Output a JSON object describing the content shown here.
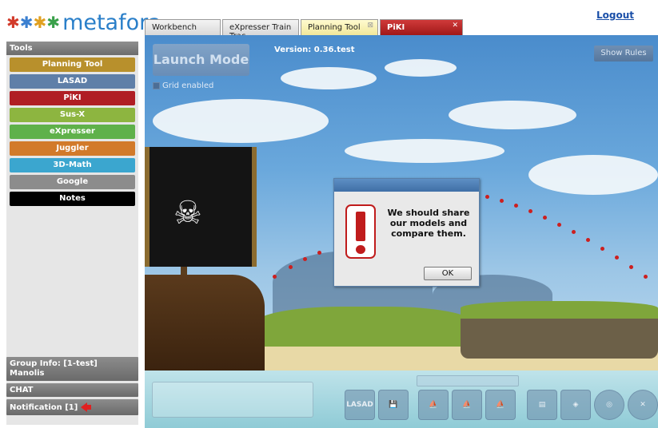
{
  "header": {
    "logo_text": "metafora",
    "logout_label": "Logout"
  },
  "tabs": [
    {
      "label": "Workbench",
      "state": "inactive"
    },
    {
      "label": "eXpresser Train Trac",
      "state": "inactive"
    },
    {
      "label": "Planning Tool",
      "state": "active",
      "close_glyph": "⊠"
    },
    {
      "label": "PiKI",
      "state": "highlighted",
      "close_glyph": "✕"
    }
  ],
  "sidebar": {
    "title": "Tools",
    "tools": [
      {
        "label": "Planning Tool",
        "color": "#b8902c"
      },
      {
        "label": "LASAD",
        "color": "#5f7fa8"
      },
      {
        "label": "PiKI",
        "color": "#b01e24"
      },
      {
        "label": "Sus-X",
        "color": "#8db540"
      },
      {
        "label": "eXpresser",
        "color": "#5fb14a"
      },
      {
        "label": "Juggler",
        "color": "#d27a2a"
      },
      {
        "label": "3D-Math",
        "color": "#3ba6cf"
      },
      {
        "label": "Google",
        "color": "#8c8c8c"
      },
      {
        "label": "Notes",
        "color": "#000000"
      }
    ],
    "group_info_line1": "Group Info: [1-test]",
    "group_info_line2": "Manolis",
    "chat_label": "CHAT",
    "notification_label": "Notification [1]"
  },
  "game": {
    "launch_mode_label": "Launch Mode",
    "version_text": "Version: 0.36.test",
    "show_rules_label": "Show Rules",
    "grid_enabled_label": "Grid enabled",
    "toolbar": {
      "lasad_label": "LASAD"
    }
  },
  "dialog": {
    "message": "We should share our models and compare them.",
    "ok_label": "OK"
  }
}
